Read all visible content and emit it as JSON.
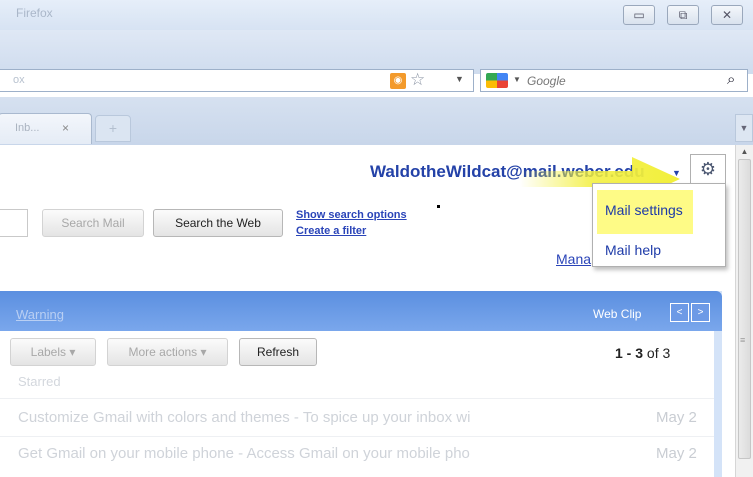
{
  "browser": {
    "window_title": "Firefox",
    "url_fragment": "ox",
    "search_engine": "Google",
    "tab_label": "Inb...",
    "tab_close": "×",
    "new_tab": "+"
  },
  "header": {
    "account_email": "WaldotheWildcat@mail.weber.edu"
  },
  "toolbar": {
    "search_mail_label": "Search Mail",
    "search_web_label": "Search the Web",
    "show_search_options": "Show search options",
    "create_filter": "Create a filter",
    "manage_label": "Mana"
  },
  "settings_menu": {
    "items": [
      {
        "label": "Mail settings",
        "highlighted": true
      },
      {
        "label": "Mail help",
        "highlighted": false
      }
    ]
  },
  "webclip": {
    "warning_label": "Warning",
    "label": "Web Clip",
    "prev": "<",
    "next": ">"
  },
  "mail_actions": {
    "labels_button": "Labels ▾",
    "more_actions_button": "More actions ▾",
    "refresh_button": "Refresh",
    "count_range": "1 - 3",
    "count_total": "of 3"
  },
  "list": {
    "section_label": "Starred",
    "rows": [
      {
        "text": "Customize Gmail with colors and themes - To spice up your inbox wi",
        "date": "May 2"
      },
      {
        "text": "Get Gmail on your mobile phone - Access Gmail on your mobile pho",
        "date": "May 2"
      }
    ]
  },
  "colors": {
    "highlight": "#fefb86",
    "arrow": "#f2ef3a",
    "link": "#2a44b8",
    "panel_header": "#5b8fe0"
  },
  "icons": [
    "gear-icon",
    "rss-icon",
    "star-icon",
    "google-icon",
    "magnifier-icon",
    "arrow-pointer-icon"
  ]
}
